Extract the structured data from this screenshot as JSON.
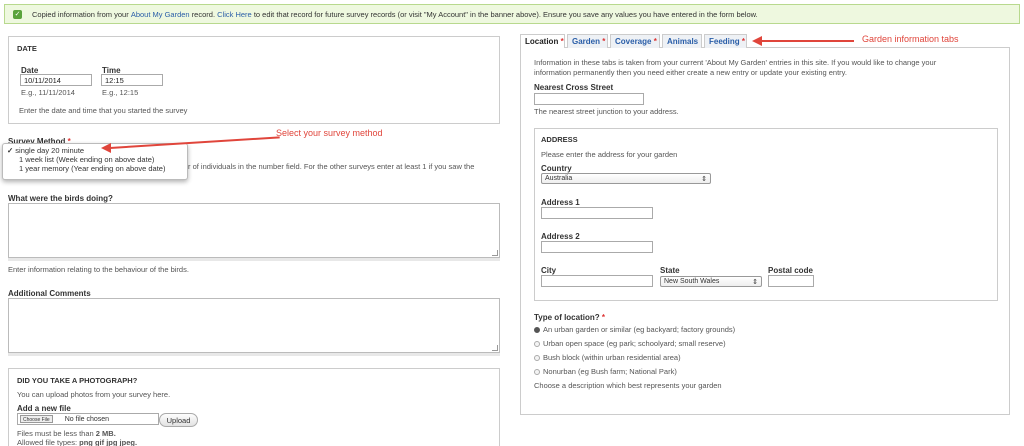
{
  "banner": {
    "text_prefix": "Copied information from your",
    "link1": "About My Garden",
    "text_mid": "record.",
    "link2": "Click Here",
    "text_suffix": "to edit that record for future survey records (or visit \"My Account\" in the banner above). Ensure you save any values you have entered in the form below."
  },
  "date_section": {
    "legend": "DATE",
    "date_label": "Date",
    "date_value": "10/11/2014",
    "date_example": "E.g., 11/11/2014",
    "time_label": "Time",
    "time_value": "12:15",
    "time_example": "E.g., 12:15",
    "help": "Enter the date and time that you started the survey"
  },
  "survey_method": {
    "label": "Survey Method",
    "required_mark": "*",
    "options": [
      "single day 20 minute",
      "1 week list (Week ending on above date)",
      "1 year memory (Year ending on above date)"
    ],
    "selected_check": "✓",
    "help_partial": "r of individuals in the number field. For the other surveys enter at least 1 if you saw the"
  },
  "birds_doing": {
    "label": "What were the birds doing?",
    "help": "Enter information relating to the behaviour of the birds."
  },
  "comments": {
    "label": "Additional Comments"
  },
  "photo": {
    "legend": "DID YOU TAKE A PHOTOGRAPH?",
    "help": "You can upload photos from your survey here.",
    "add_label": "Add a new file",
    "choose_label": "Choose File",
    "no_file": "No file chosen",
    "upload_button": "Upload",
    "size_note_prefix": "Files must be less than",
    "size_value": "2 MB.",
    "types_prefix": "Allowed file types:",
    "types_value": "png gif jpg jpeg."
  },
  "callouts": {
    "survey": "Select your survey method",
    "tabs": "Garden information tabs"
  },
  "tabs": [
    {
      "label": "Location",
      "mark": "*"
    },
    {
      "label": "Garden",
      "mark": "*"
    },
    {
      "label": "Coverage",
      "mark": "*"
    },
    {
      "label": "Animals",
      "mark": ""
    },
    {
      "label": "Feeding",
      "mark": "*"
    }
  ],
  "garden": {
    "intro": "Information in these tabs is taken from your current 'About My Garden' entries in this site. If you would like to change your information permanently then you need either create a new entry or update your existing entry.",
    "cross_street_label": "Nearest Cross Street",
    "cross_street_help": "The nearest street junction to your address.",
    "address_legend": "ADDRESS",
    "address_help": "Please enter the address for your garden",
    "country_label": "Country",
    "country_value": "Australia",
    "address1_label": "Address 1",
    "address2_label": "Address 2",
    "city_label": "City",
    "state_label": "State",
    "state_value": "New South Wales",
    "postal_label": "Postal code",
    "location_type_label": "Type of location?",
    "location_types": [
      "An urban garden or similar (eg backyard; factory grounds)",
      "Urban open space (eg park; schoolyard; small reserve)",
      "Bush block (within urban residential area)",
      "Nonurban (eg Bush farm; National Park)"
    ],
    "location_help": "Choose a description which best represents your garden"
  },
  "colors": {
    "banner_bg": "#eef8df",
    "banner_border": "#b8d98e",
    "accent_red": "#e0453b",
    "link_blue": "#2a5ea8"
  }
}
